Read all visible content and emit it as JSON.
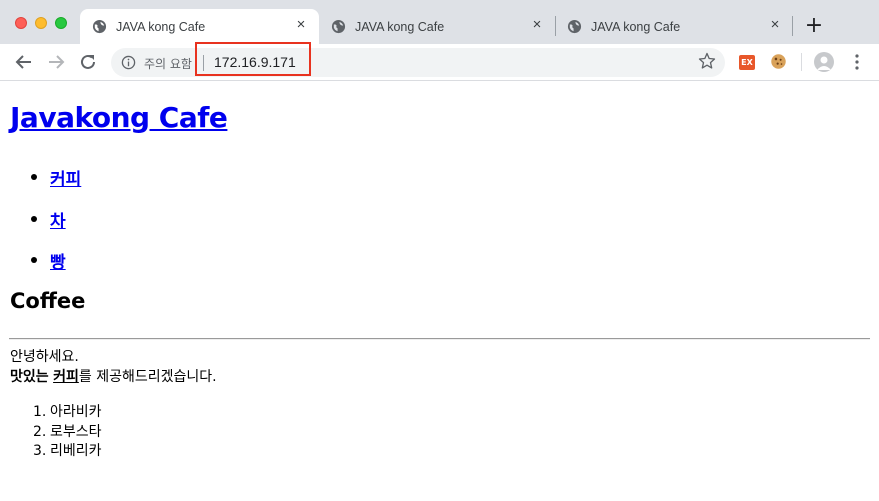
{
  "browser": {
    "tabs": [
      {
        "title": "JAVA kong Cafe",
        "active": true
      },
      {
        "title": "JAVA kong Cafe",
        "active": false
      },
      {
        "title": "JAVA kong Cafe",
        "active": false
      }
    ],
    "close_glyph": "×",
    "new_tab_glyph": "+",
    "security_label": "주의 요함",
    "url": "172.16.9.171",
    "highlight_color": "#e8321f",
    "extensions": [
      {
        "name": "ex-extension-icon",
        "label": "EX"
      },
      {
        "name": "cookie-extension-icon"
      }
    ]
  },
  "page": {
    "site_title": "Javakong Cafe",
    "nav": [
      "커피",
      "차",
      "빵"
    ],
    "section_title": "Coffee",
    "greeting": "안녕하세요.",
    "description": {
      "prefix_bold": "맛있는",
      "link_word": "커피",
      "suffix": "를 제공해드리겠습니다."
    },
    "coffee_list": [
      "아라비카",
      "로부스타",
      "리베리카"
    ],
    "list_numbers": [
      "1.",
      "2.",
      "3."
    ]
  }
}
